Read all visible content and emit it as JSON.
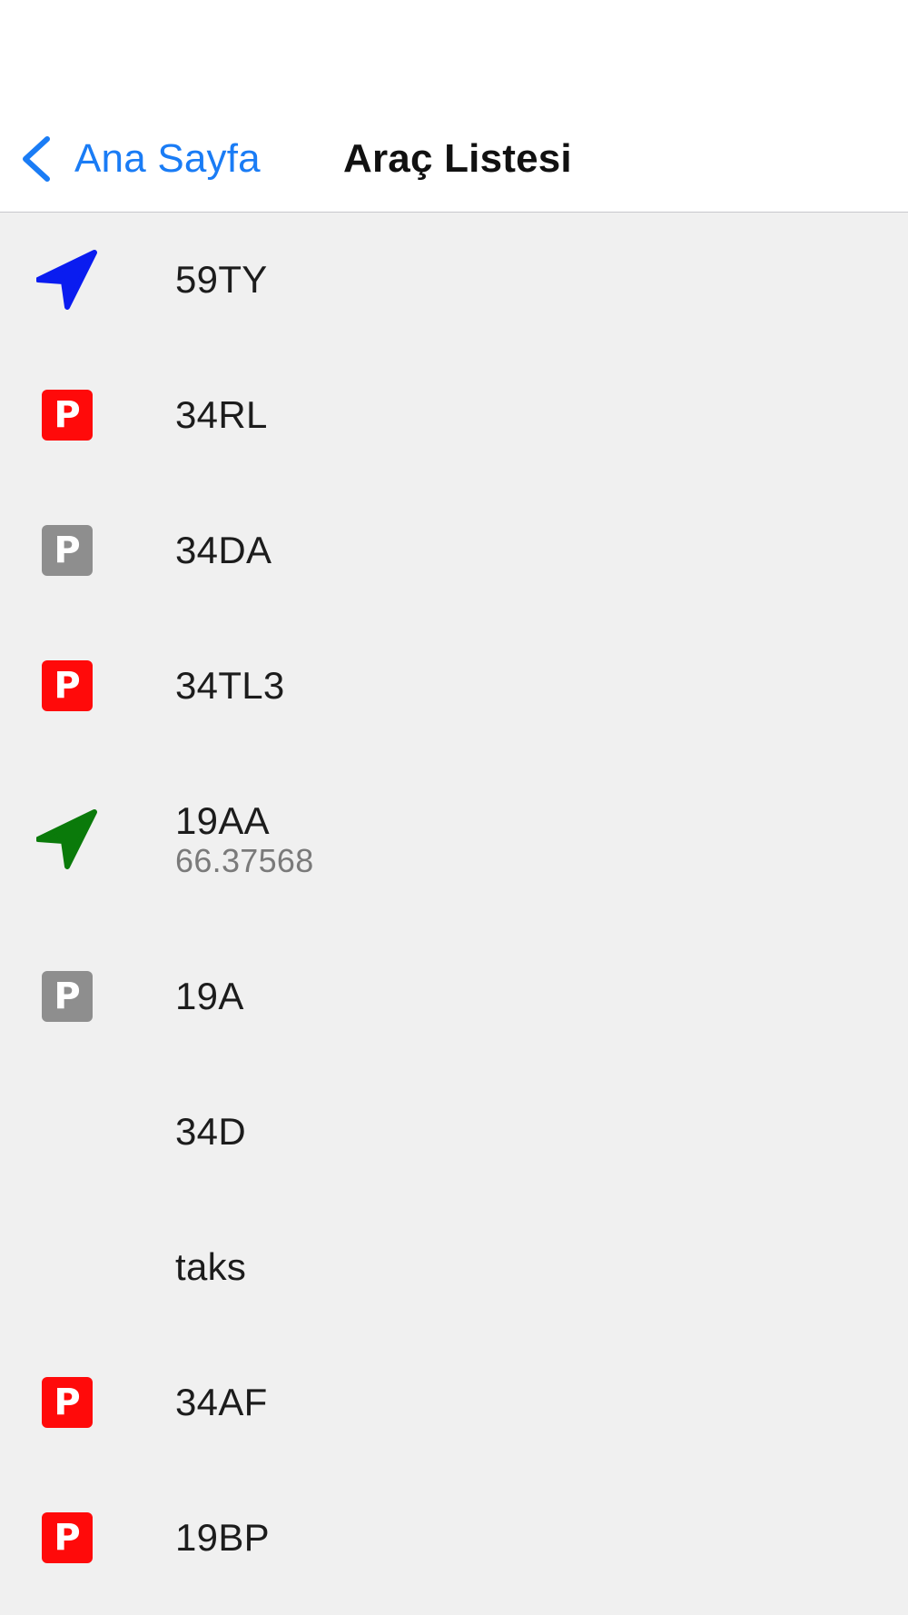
{
  "nav": {
    "back_label": "Ana Sayfa",
    "title": "Araç Listesi",
    "back_icon": "chevron-left-icon",
    "accent_color": "#1a7cf5"
  },
  "vehicles": [
    {
      "plate": "59TY",
      "subtitle": "",
      "status_icon": "navigation-arrow-icon",
      "icon_color": "#0a1cf0"
    },
    {
      "plate": "34RL",
      "subtitle": "",
      "status_icon": "parking-icon",
      "icon_color": "#ff0a0a",
      "badge_letter": "P"
    },
    {
      "plate": "34DA",
      "subtitle": "",
      "status_icon": "parking-icon",
      "icon_color": "#8e8e8e",
      "badge_letter": "P"
    },
    {
      "plate": "34TL3",
      "subtitle": "",
      "status_icon": "parking-icon",
      "icon_color": "#ff0a0a",
      "badge_letter": "P"
    },
    {
      "plate": "19AA",
      "subtitle": "66.37568",
      "status_icon": "navigation-arrow-icon",
      "icon_color": "#0a7a0a"
    },
    {
      "plate": "19A",
      "subtitle": "",
      "status_icon": "parking-icon",
      "icon_color": "#8e8e8e",
      "badge_letter": "P"
    },
    {
      "plate": "34D",
      "subtitle": "",
      "status_icon": "none"
    },
    {
      "plate": "taks",
      "subtitle": "",
      "status_icon": "none"
    },
    {
      "plate": "34AF",
      "subtitle": "",
      "status_icon": "parking-icon",
      "icon_color": "#ff0a0a",
      "badge_letter": "P"
    },
    {
      "plate": "19BP",
      "subtitle": "",
      "status_icon": "parking-icon",
      "icon_color": "#ff0a0a",
      "badge_letter": "P"
    }
  ]
}
